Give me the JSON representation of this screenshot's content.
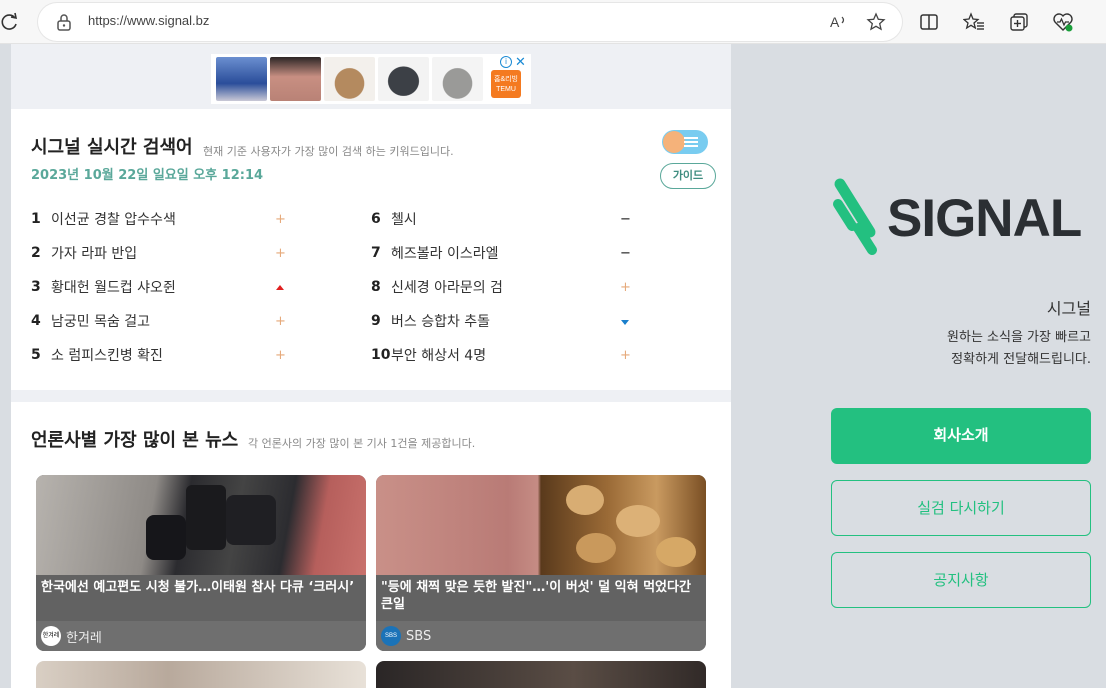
{
  "browser": {
    "url": "https://www.signal.bz"
  },
  "ad": {
    "brand": "TEMU",
    "brand_kr": "홈&리빙",
    "info": "i",
    "close": "✕"
  },
  "realtime": {
    "title": "시그널 실시간 검색어",
    "subtitle": "현재 기준 사용자가 가장 많이 검색 하는 키워드입니다.",
    "datetime": "2023년 10월 22일 일요일 오후 12:14",
    "guide_label": "가이드",
    "keywords": [
      {
        "rank": "1",
        "text": "이선균 경찰 압수수색",
        "trend": "plus"
      },
      {
        "rank": "2",
        "text": "가자 라파 반입",
        "trend": "plus"
      },
      {
        "rank": "3",
        "text": "황대헌 월드컵 샤오쥔",
        "trend": "up"
      },
      {
        "rank": "4",
        "text": "남궁민 목숨 걸고",
        "trend": "plus"
      },
      {
        "rank": "5",
        "text": "소 럼피스킨병 확진",
        "trend": "plus"
      },
      {
        "rank": "6",
        "text": "첼시",
        "trend": "minus"
      },
      {
        "rank": "7",
        "text": "헤즈볼라 이스라엘",
        "trend": "minus"
      },
      {
        "rank": "8",
        "text": "신세경 아라문의 검",
        "trend": "plus"
      },
      {
        "rank": "9",
        "text": "버스 승합차 추돌",
        "trend": "down"
      },
      {
        "rank": "10",
        "text": "부안 해상서 4명",
        "trend": "plus"
      }
    ]
  },
  "news": {
    "title": "언론사별 가장 많이 본 뉴스",
    "subtitle": "각 언론사의 가장 많이 본 기사 1건을 제공합니다.",
    "cards": [
      {
        "headline": "한국에선 예고편도 시청 불가…이태원 참사 다큐 ‘크러시’",
        "source": "한겨레",
        "logo": "한겨레"
      },
      {
        "headline": "\"등에 채찍 맞은 듯한 발진\"…'이 버섯' 덜 익혀 먹었다간 큰일",
        "source": "SBS",
        "logo": "SBS"
      }
    ]
  },
  "side": {
    "brand": "SIGNAL",
    "name": "시그널",
    "desc_line1": "원하는 소식을 가장 빠르고",
    "desc_line2": "정확하게 전달해드립니다.",
    "buttons": [
      "회사소개",
      "실검 다시하기",
      "공지사항"
    ]
  },
  "colors": {
    "accent": "#23c080",
    "date": "#5aa89a",
    "trend_up": "#e02020",
    "trend_down": "#1a7fcc",
    "trend_plus": "#e6a97a"
  }
}
